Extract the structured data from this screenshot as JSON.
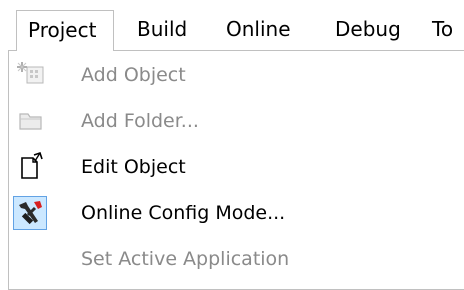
{
  "menubar": {
    "items": [
      {
        "label": "Project"
      },
      {
        "label": "Build"
      },
      {
        "label": "Online"
      },
      {
        "label": "Debug"
      },
      {
        "label": "To"
      }
    ]
  },
  "dropdown": {
    "items": [
      {
        "label": "Add Object",
        "enabled": false,
        "icon": "add-object-icon"
      },
      {
        "label": "Add Folder...",
        "enabled": false,
        "icon": "folder-icon"
      },
      {
        "label": "Edit Object",
        "enabled": true,
        "icon": "edit-object-icon"
      },
      {
        "label": "Online Config Mode...",
        "enabled": true,
        "checked": true,
        "icon": "online-config-icon"
      },
      {
        "label": "Set Active Application",
        "enabled": false,
        "icon": ""
      }
    ]
  }
}
